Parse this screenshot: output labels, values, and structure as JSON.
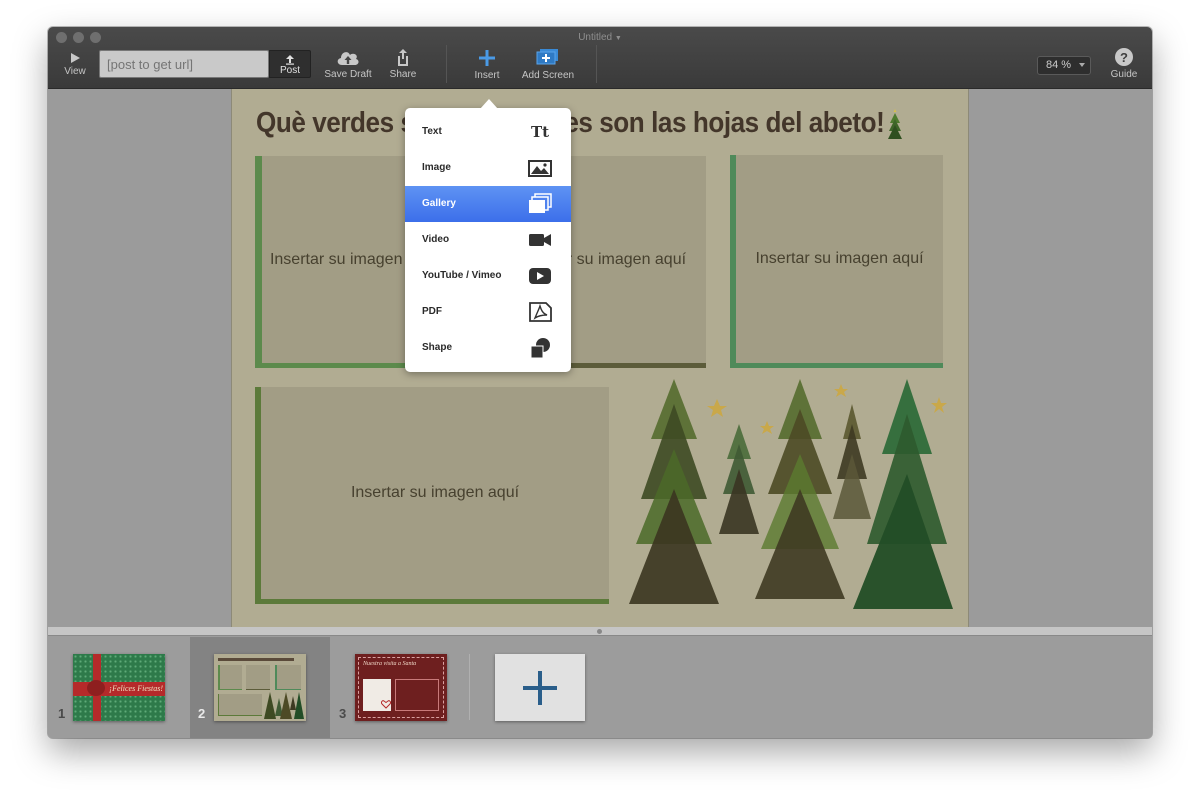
{
  "window": {
    "title": "Untitled"
  },
  "toolbar": {
    "view_label": "View",
    "url_placeholder": "[post to get url]",
    "post_label": "Post",
    "save_draft_label": "Save Draft",
    "share_label": "Share",
    "insert_label": "Insert",
    "add_screen_label": "Add Screen",
    "zoom_value": "84 %",
    "guide_label": "Guide"
  },
  "page": {
    "title": "Què verdes son, qué verdes son las hojas del abeto!",
    "placeholders": [
      "Insertar su imagen aquí",
      "Insertar su imagen aquí",
      "Insertar su imagen aquí",
      "Insertar su imagen aquí"
    ]
  },
  "insert_menu": {
    "items": [
      {
        "label": "Text",
        "icon": "text-icon",
        "active": false
      },
      {
        "label": "Image",
        "icon": "image-icon",
        "active": false
      },
      {
        "label": "Gallery",
        "icon": "gallery-icon",
        "active": true
      },
      {
        "label": "Video",
        "icon": "video-camera-icon",
        "active": false
      },
      {
        "label": "YouTube / Vimeo",
        "icon": "play-icon",
        "active": false
      },
      {
        "label": "PDF",
        "icon": "pdf-icon",
        "active": false
      },
      {
        "label": "Shape",
        "icon": "shape-icon",
        "active": false
      }
    ],
    "text_icon_glyph": "Tt",
    "active_color": "#4a80ef"
  },
  "filmstrip": {
    "screens": [
      {
        "number": "1",
        "selected": false,
        "caption": "¡Felices Fiestas!",
        "color": "#2e7a4a"
      },
      {
        "number": "2",
        "selected": true,
        "caption": "",
        "color": "#b1ac92"
      },
      {
        "number": "3",
        "selected": false,
        "caption": "Nuestra visita a Santa",
        "color": "#6e1f1f"
      }
    ]
  },
  "colors": {
    "titlebar": "#3f3f3f",
    "page_background": "#b1ac92",
    "add_screen_plus": "#2a5e8a"
  }
}
